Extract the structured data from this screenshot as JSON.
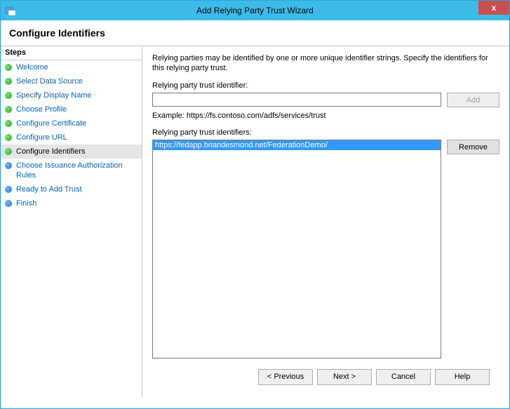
{
  "window": {
    "title": "Add Relying Party Trust Wizard",
    "close": "x"
  },
  "header": {
    "title": "Configure Identifiers"
  },
  "sidebar": {
    "header": "Steps",
    "items": [
      {
        "label": "Welcome",
        "bullet": "green",
        "current": false
      },
      {
        "label": "Select Data Source",
        "bullet": "green",
        "current": false
      },
      {
        "label": "Specify Display Name",
        "bullet": "green",
        "current": false
      },
      {
        "label": "Choose Profile",
        "bullet": "green",
        "current": false
      },
      {
        "label": "Configure Certificate",
        "bullet": "green",
        "current": false
      },
      {
        "label": "Configure URL",
        "bullet": "green",
        "current": false
      },
      {
        "label": "Configure Identifiers",
        "bullet": "green",
        "current": true
      },
      {
        "label": "Choose Issuance Authorization Rules",
        "bullet": "blue",
        "current": false
      },
      {
        "label": "Ready to Add Trust",
        "bullet": "blue",
        "current": false
      },
      {
        "label": "Finish",
        "bullet": "blue",
        "current": false
      }
    ]
  },
  "main": {
    "instruction": "Relying parties may be identified by one or more unique identifier strings. Specify the identifiers for this relying party trust.",
    "identifier_label": "Relying party trust identifier:",
    "identifier_value": "",
    "add_label": "Add",
    "example": "Example: https://fs.contoso.com/adfs/services/trust",
    "identifiers_label": "Relying party trust identifiers:",
    "identifiers": [
      "https://fedapp.briandesmond.net/FederationDemo/"
    ],
    "remove_label": "Remove"
  },
  "footer": {
    "previous": "< Previous",
    "next": "Next >",
    "cancel": "Cancel",
    "help": "Help"
  }
}
